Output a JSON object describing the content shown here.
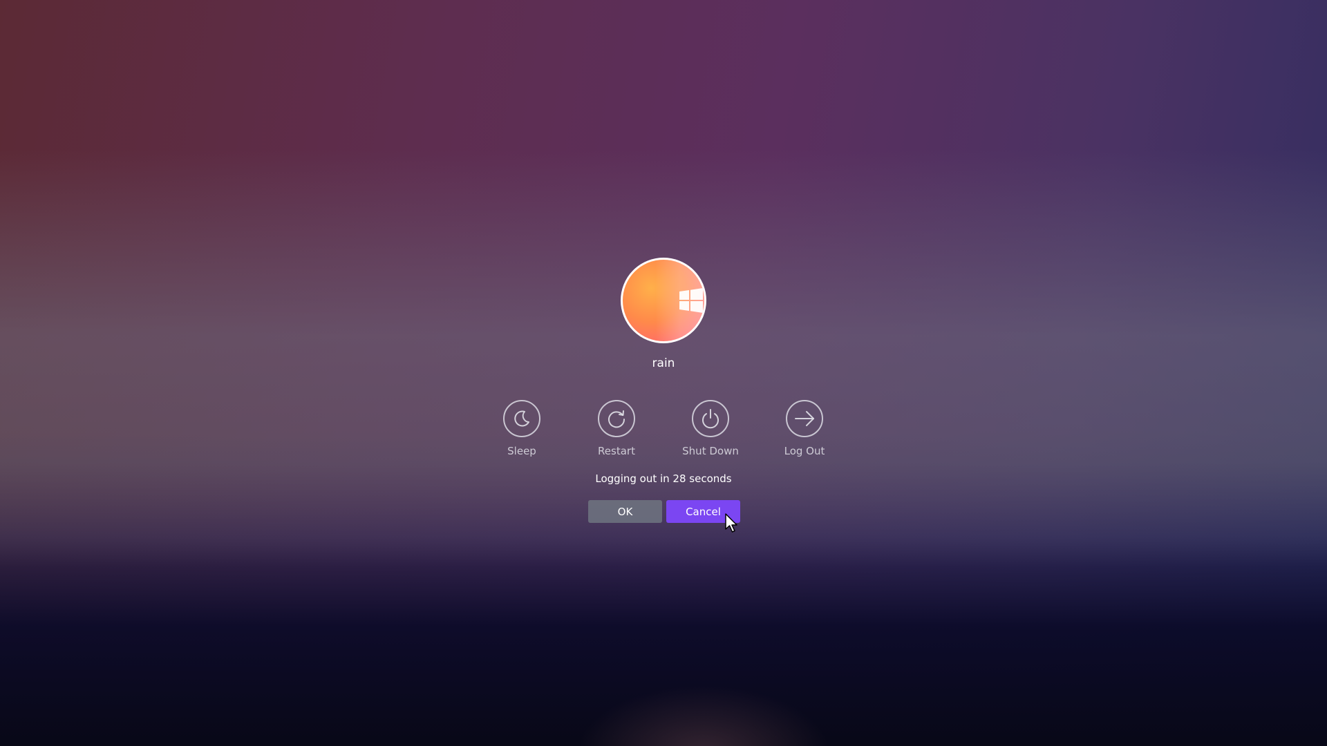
{
  "user": {
    "name": "rain"
  },
  "actions": [
    {
      "id": "sleep",
      "label": "Sleep",
      "icon": "moon-icon"
    },
    {
      "id": "restart",
      "label": "Restart",
      "icon": "restart-icon"
    },
    {
      "id": "shutdown",
      "label": "Shut Down",
      "icon": "power-icon"
    },
    {
      "id": "logout",
      "label": "Log Out",
      "icon": "arrow-right-icon"
    }
  ],
  "countdown": {
    "text": "Logging out in 28 seconds"
  },
  "buttons": {
    "ok_label": "OK",
    "cancel_label": "Cancel"
  },
  "colors": {
    "accent": "#7b46f2",
    "ok_button": "#6e7480"
  }
}
